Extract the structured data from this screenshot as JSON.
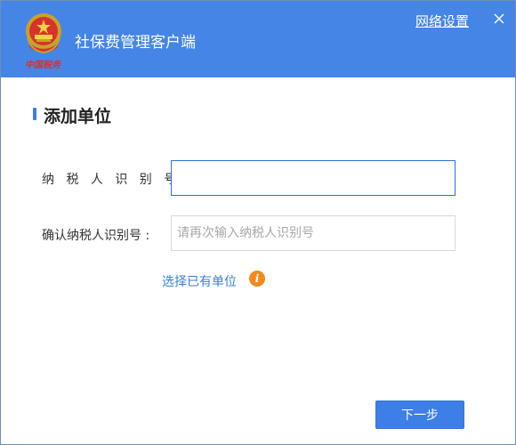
{
  "window": {
    "app_title": "社保费管理客户端",
    "logo_text": "中国税务",
    "network_settings_label": "网络设置",
    "close_icon": "close-icon",
    "brand_color": "#4585e6"
  },
  "form": {
    "section_title": "添加单位",
    "taxpayer_id_label": "纳 税 人 识 别 号 :",
    "taxpayer_id_value": "",
    "taxpayer_id_placeholder": "",
    "confirm_id_label": "确认纳税人识别号 :",
    "confirm_id_value": "",
    "confirm_id_placeholder": "请再次输入纳税人识别号",
    "select_existing_label": "选择已有单位",
    "info_icon": "info-icon"
  },
  "footer": {
    "next_button_label": "下一步"
  }
}
